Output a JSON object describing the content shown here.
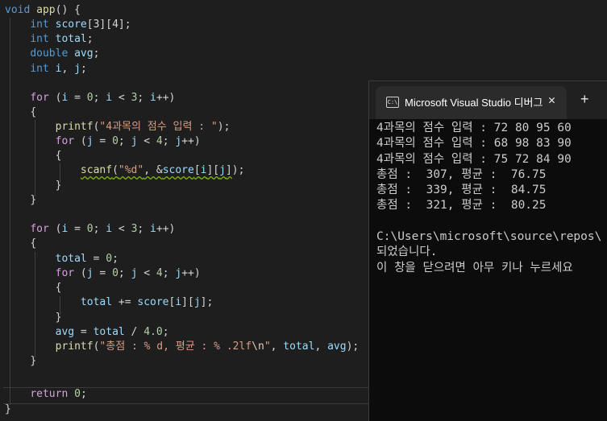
{
  "code_lines": [
    [
      {
        "t": "void",
        "c": "kw"
      },
      {
        "t": " "
      },
      {
        "t": "app",
        "c": "fn"
      },
      {
        "t": "() {"
      }
    ],
    [
      {
        "t": "int",
        "c": "typ"
      },
      {
        "t": " "
      },
      {
        "t": "score",
        "c": "var"
      },
      {
        "t": "[3][4];"
      }
    ],
    [
      {
        "t": "int",
        "c": "typ"
      },
      {
        "t": " "
      },
      {
        "t": "total",
        "c": "var"
      },
      {
        "t": ";"
      }
    ],
    [
      {
        "t": "double",
        "c": "typ"
      },
      {
        "t": " "
      },
      {
        "t": "avg",
        "c": "var"
      },
      {
        "t": ";"
      }
    ],
    [
      {
        "t": "int",
        "c": "typ"
      },
      {
        "t": " "
      },
      {
        "t": "i",
        "c": "var"
      },
      {
        "t": ", "
      },
      {
        "t": "j",
        "c": "var"
      },
      {
        "t": ";"
      }
    ],
    [],
    [
      {
        "t": "for",
        "c": "ctl"
      },
      {
        "t": " ("
      },
      {
        "t": "i",
        "c": "var"
      },
      {
        "t": " = "
      },
      {
        "t": "0",
        "c": "num"
      },
      {
        "t": "; "
      },
      {
        "t": "i",
        "c": "var"
      },
      {
        "t": " < "
      },
      {
        "t": "3",
        "c": "num"
      },
      {
        "t": "; "
      },
      {
        "t": "i",
        "c": "var"
      },
      {
        "t": "++)"
      }
    ],
    [
      {
        "t": "{"
      }
    ],
    [
      {
        "t": "printf",
        "c": "fn"
      },
      {
        "t": "("
      },
      {
        "t": "\"4과목의 점수 입력 : \"",
        "c": "str"
      },
      {
        "t": ");"
      }
    ],
    [
      {
        "t": "for",
        "c": "ctl"
      },
      {
        "t": " ("
      },
      {
        "t": "j",
        "c": "var"
      },
      {
        "t": " = "
      },
      {
        "t": "0",
        "c": "num"
      },
      {
        "t": "; "
      },
      {
        "t": "j",
        "c": "var"
      },
      {
        "t": " < "
      },
      {
        "t": "4",
        "c": "num"
      },
      {
        "t": "; "
      },
      {
        "t": "j",
        "c": "var"
      },
      {
        "t": "++)"
      }
    ],
    [
      {
        "t": "{"
      }
    ],
    [
      {
        "t": "scanf",
        "c": "fn sq"
      },
      {
        "t": "(",
        "c": "pl sq"
      },
      {
        "t": "\"%d\"",
        "c": "str sq"
      },
      {
        "t": ", &",
        "c": "pl sq"
      },
      {
        "t": "score",
        "c": "var sq"
      },
      {
        "t": "[",
        "c": "pl sq"
      },
      {
        "t": "i",
        "c": "var sq"
      },
      {
        "t": "][",
        "c": "pl sq"
      },
      {
        "t": "j",
        "c": "var sq"
      },
      {
        "t": "]",
        "c": "pl sq"
      },
      {
        "t": ");"
      }
    ],
    [
      {
        "t": "}"
      }
    ],
    [
      {
        "t": "}"
      }
    ],
    [],
    [
      {
        "t": "for",
        "c": "ctl"
      },
      {
        "t": " ("
      },
      {
        "t": "i",
        "c": "var"
      },
      {
        "t": " = "
      },
      {
        "t": "0",
        "c": "num"
      },
      {
        "t": "; "
      },
      {
        "t": "i",
        "c": "var"
      },
      {
        "t": " < "
      },
      {
        "t": "3",
        "c": "num"
      },
      {
        "t": "; "
      },
      {
        "t": "i",
        "c": "var"
      },
      {
        "t": "++)"
      }
    ],
    [
      {
        "t": "{"
      }
    ],
    [
      {
        "t": "total",
        "c": "var"
      },
      {
        "t": " = "
      },
      {
        "t": "0",
        "c": "num"
      },
      {
        "t": ";"
      }
    ],
    [
      {
        "t": "for",
        "c": "ctl"
      },
      {
        "t": " ("
      },
      {
        "t": "j",
        "c": "var"
      },
      {
        "t": " = "
      },
      {
        "t": "0",
        "c": "num"
      },
      {
        "t": "; "
      },
      {
        "t": "j",
        "c": "var"
      },
      {
        "t": " < "
      },
      {
        "t": "4",
        "c": "num"
      },
      {
        "t": "; "
      },
      {
        "t": "j",
        "c": "var"
      },
      {
        "t": "++)"
      }
    ],
    [
      {
        "t": "{"
      }
    ],
    [
      {
        "t": "total",
        "c": "var"
      },
      {
        "t": " += "
      },
      {
        "t": "score",
        "c": "var"
      },
      {
        "t": "["
      },
      {
        "t": "i",
        "c": "var"
      },
      {
        "t": "]["
      },
      {
        "t": "j",
        "c": "var"
      },
      {
        "t": "];"
      }
    ],
    [
      {
        "t": "}"
      }
    ],
    [
      {
        "t": "avg",
        "c": "var"
      },
      {
        "t": " = "
      },
      {
        "t": "total",
        "c": "var"
      },
      {
        "t": " / "
      },
      {
        "t": "4.0",
        "c": "num"
      },
      {
        "t": ";"
      }
    ],
    [
      {
        "t": "printf",
        "c": "fn"
      },
      {
        "t": "("
      },
      {
        "t": "\"총점 : % d, 평균 : % .2lf",
        "c": "str"
      },
      {
        "t": "\\n",
        "c": "esc"
      },
      {
        "t": "\"",
        "c": "str"
      },
      {
        "t": ", "
      },
      {
        "t": "total",
        "c": "var"
      },
      {
        "t": ", "
      },
      {
        "t": "avg",
        "c": "var"
      },
      {
        "t": ");"
      }
    ],
    [
      {
        "t": "}"
      }
    ],
    [],
    [
      {
        "t": "return",
        "c": "ctl"
      },
      {
        "t": " "
      },
      {
        "t": "0",
        "c": "num"
      },
      {
        "t": ";"
      }
    ],
    [
      {
        "t": "}"
      }
    ]
  ],
  "terminal": {
    "tab_title": "Microsoft Visual Studio 디버그",
    "tab_icon_text": "C:\\",
    "close_glyph": "✕",
    "new_tab_glyph": "+",
    "lines": [
      "4과목의 점수 입력 : 72 80 95 60",
      "4과목의 점수 입력 : 68 98 83 90",
      "4과목의 점수 입력 : 75 72 84 90",
      "총점 :  307, 평균 :  76.75",
      "총점 :  339, 평균 :  84.75",
      "총점 :  321, 평균 :  80.25",
      "",
      "C:\\Users\\microsoft\\source\\repos\\",
      "되었습니다.",
      "이 창을 닫으려면 아무 키나 누르세요"
    ]
  }
}
